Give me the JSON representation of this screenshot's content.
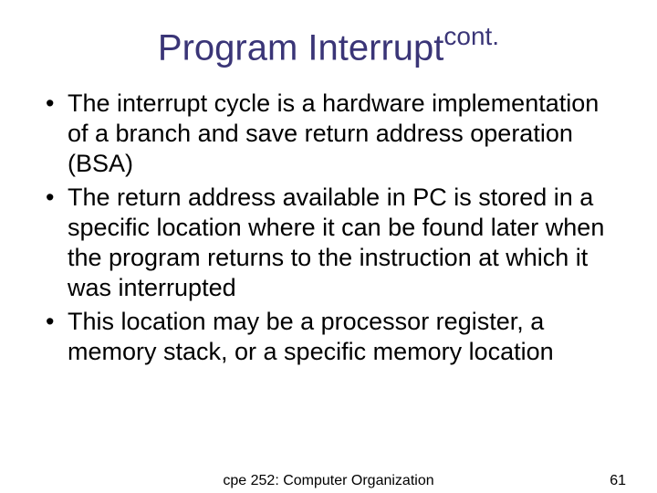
{
  "title": {
    "main": "Program Interrupt",
    "sup": "cont."
  },
  "bullets": [
    "The interrupt cycle is a hardware implementation of a branch and save return address operation (BSA)",
    "The return address available in PC is stored in a specific location where it can be found later when the program returns to the instruction at which it was interrupted",
    "This location may be a processor register, a memory stack, or a specific memory location"
  ],
  "footer": {
    "center": "cpe 252: Computer Organization",
    "page": "61"
  }
}
